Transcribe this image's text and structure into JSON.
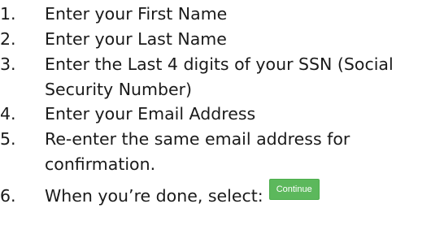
{
  "instructions": {
    "steps": [
      {
        "number": "1.",
        "lines": [
          "Enter your First Name"
        ]
      },
      {
        "number": "2.",
        "lines": [
          "Enter your Last Name"
        ]
      },
      {
        "number": "3.",
        "lines": [
          "Enter the Last 4 digits of your SSN (Social",
          "Security Number)"
        ]
      },
      {
        "number": "4.",
        "lines": [
          "Enter your Email Address"
        ]
      },
      {
        "number": "5.",
        "lines": [
          "Re-enter the same email address for",
          "confirmation."
        ]
      },
      {
        "number": "6.",
        "lines": [
          "When you’re done, select:"
        ]
      }
    ],
    "continue_button": "Continue"
  }
}
